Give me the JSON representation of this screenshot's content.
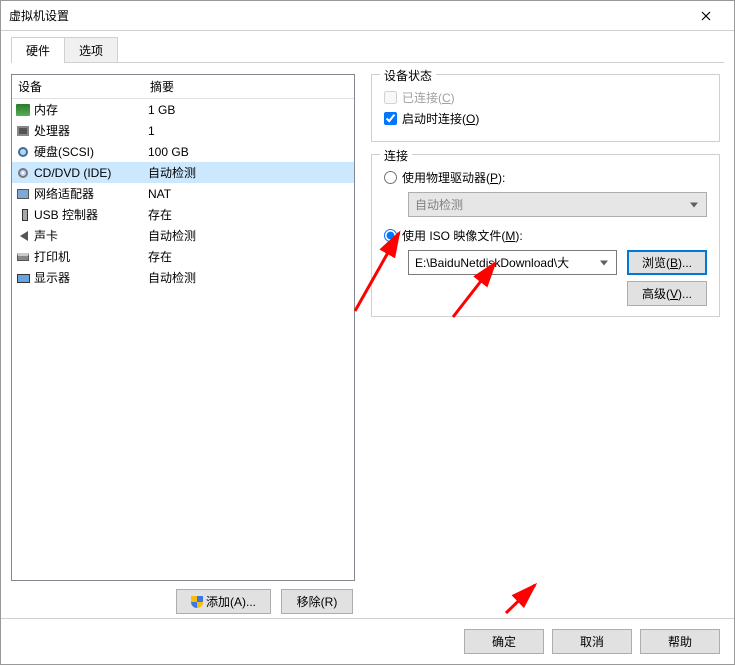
{
  "window": {
    "title": "虚拟机设置"
  },
  "tabs": {
    "hardware": "硬件",
    "options": "选项"
  },
  "table": {
    "col_device": "设备",
    "col_summary": "摘要",
    "rows": [
      {
        "icon": "mem",
        "name": "内存",
        "summary": "1 GB"
      },
      {
        "icon": "cpu",
        "name": "处理器",
        "summary": "1"
      },
      {
        "icon": "disk",
        "name": "硬盘(SCSI)",
        "summary": "100 GB"
      },
      {
        "icon": "cd",
        "name": "CD/DVD (IDE)",
        "summary": "自动检测",
        "selected": true
      },
      {
        "icon": "net",
        "name": "网络适配器",
        "summary": "NAT"
      },
      {
        "icon": "usb",
        "name": "USB 控制器",
        "summary": "存在"
      },
      {
        "icon": "snd",
        "name": "声卡",
        "summary": "自动检测"
      },
      {
        "icon": "prn",
        "name": "打印机",
        "summary": "存在"
      },
      {
        "icon": "disp",
        "name": "显示器",
        "summary": "自动检测"
      }
    ]
  },
  "left_buttons": {
    "add": "添加(A)...",
    "remove": "移除(R)"
  },
  "status_group": {
    "legend": "设备状态",
    "connected": "已连接(C)",
    "connect_at_power": "启动时连接(O)"
  },
  "conn_group": {
    "legend": "连接",
    "use_physical": "使用物理驱动器(P):",
    "physical_value": "自动检测",
    "use_iso": "使用 ISO 映像文件(M):",
    "iso_path": "E:\\BaiduNetdiskDownload\\大",
    "browse": "浏览(B)...",
    "advanced": "高级(V)..."
  },
  "footer": {
    "ok": "确定",
    "cancel": "取消",
    "help": "帮助"
  }
}
